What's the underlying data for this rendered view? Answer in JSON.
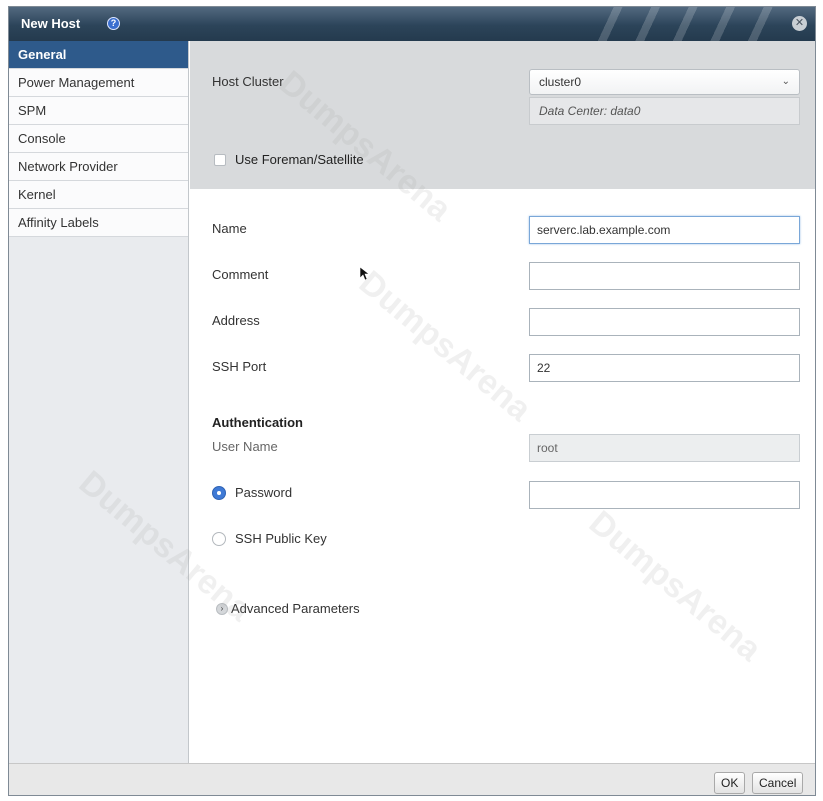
{
  "dialog": {
    "title": "New Host",
    "help_icon": "help-icon",
    "close_icon": "close-icon"
  },
  "sidebar": {
    "items": [
      {
        "label": "General",
        "active": true
      },
      {
        "label": "Power Management",
        "active": false
      },
      {
        "label": "SPM",
        "active": false
      },
      {
        "label": "Console",
        "active": false
      },
      {
        "label": "Network Provider",
        "active": false
      },
      {
        "label": "Kernel",
        "active": false
      },
      {
        "label": "Affinity Labels",
        "active": false
      }
    ]
  },
  "form": {
    "host_cluster_label": "Host Cluster",
    "host_cluster_value": "cluster0",
    "data_center_note": "Data Center: data0",
    "foreman_label": "Use Foreman/Satellite",
    "foreman_checked": false,
    "name_label": "Name",
    "name_value": "serverc.lab.example.com",
    "comment_label": "Comment",
    "comment_value": "",
    "address_label": "Address",
    "address_value": "",
    "ssh_port_label": "SSH Port",
    "ssh_port_value": "22",
    "auth_heading": "Authentication",
    "user_name_label": "User Name",
    "user_name_value": "root",
    "password_label": "Password",
    "password_value": "",
    "ssh_key_label": "SSH Public Key",
    "auth_selected": "Password",
    "advanced_label": "Advanced Parameters"
  },
  "footer": {
    "ok_label": "OK",
    "cancel_label": "Cancel"
  },
  "watermark": "DumpsArena",
  "colors": {
    "titlebar": "#2c4459",
    "active_tab": "#2e5a8b",
    "radio_selected": "#3f7ad6"
  }
}
